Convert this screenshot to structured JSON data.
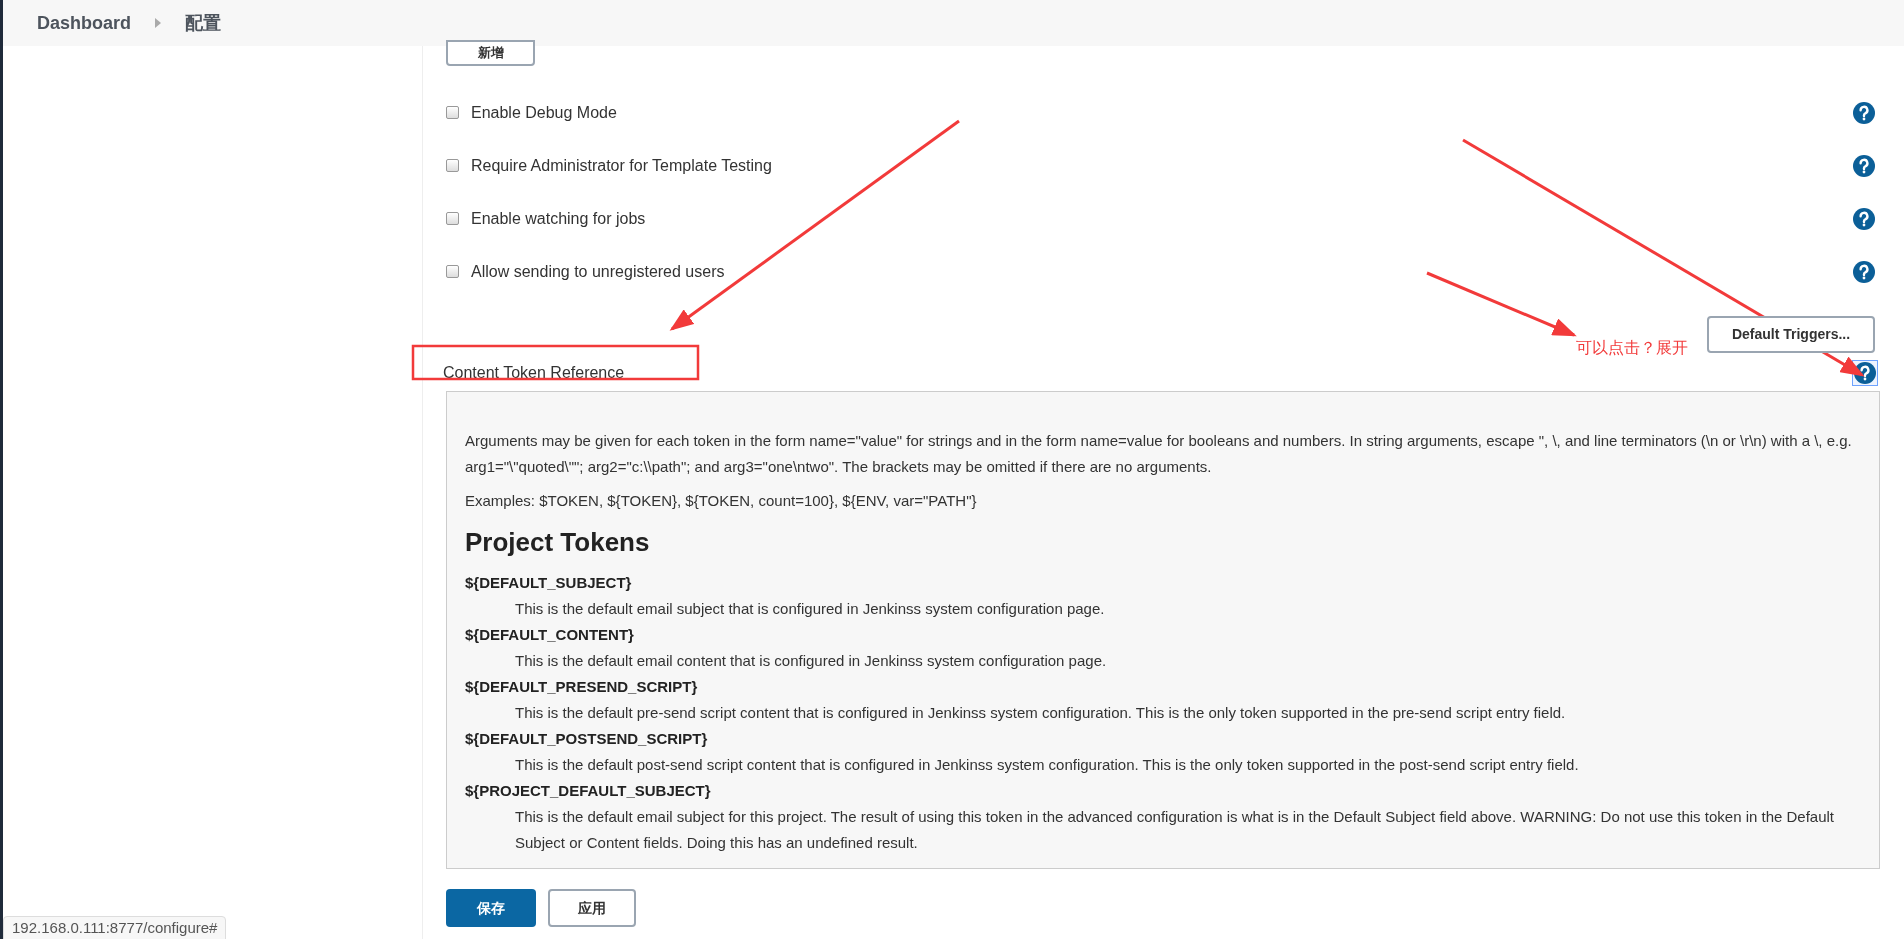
{
  "breadcrumb": [
    {
      "label": "Dashboard"
    },
    {
      "label": "配置"
    }
  ],
  "add_button": "新增",
  "options": [
    {
      "label": "Enable Debug Mode",
      "checked": false
    },
    {
      "label": "Require Administrator for Template Testing",
      "checked": false
    },
    {
      "label": "Enable watching for jobs",
      "checked": false
    },
    {
      "label": "Allow sending to unregistered users",
      "checked": false
    }
  ],
  "default_triggers_button": "Default Triggers...",
  "section": {
    "title": "Content Token Reference",
    "help_expanded": true
  },
  "help_panel": {
    "paragraphs": [
      "Arguments may be given for each token in the form name=\"value\" for strings and in the form name=value for booleans and numbers. In string arguments, escape \", \\, and line terminators (\\n or \\r\\n) with a \\, e.g. arg1=\"\\\"quoted\\\"\"; arg2=\"c:\\\\path\"; and arg3=\"one\\ntwo\". The brackets may be omitted if there are no arguments.",
      "Examples: $TOKEN, ${TOKEN}, ${TOKEN, count=100}, ${ENV, var=\"PATH\"}"
    ],
    "heading": "Project Tokens",
    "tokens": [
      {
        "name": "${DEFAULT_SUBJECT}",
        "description": "This is the default email subject that is configured in Jenkinss system configuration page."
      },
      {
        "name": "${DEFAULT_CONTENT}",
        "description": "This is the default email content that is configured in Jenkinss system configuration page."
      },
      {
        "name": "${DEFAULT_PRESEND_SCRIPT}",
        "description": "This is the default pre-send script content that is configured in Jenkinss system configuration. This is the only token supported in the pre-send script entry field."
      },
      {
        "name": "${DEFAULT_POSTSEND_SCRIPT}",
        "description": "This is the default post-send script content that is configured in Jenkinss system configuration. This is the only token supported in the post-send script entry field."
      },
      {
        "name": "${PROJECT_DEFAULT_SUBJECT}",
        "description": "This is the default email subject for this project. The result of using this token in the advanced configuration is what is in the Default Subject field above. WARNING: Do not use this token in the Default Subject or Content fields. Doing this has an undefined result."
      }
    ]
  },
  "buttons": [
    {
      "label": "保存",
      "kind": "primary"
    },
    {
      "label": "应用",
      "kind": "secondary"
    }
  ],
  "status_url": "192.168.0.111:8777/configure#",
  "annotation": {
    "text": "可以点击？展开"
  }
}
